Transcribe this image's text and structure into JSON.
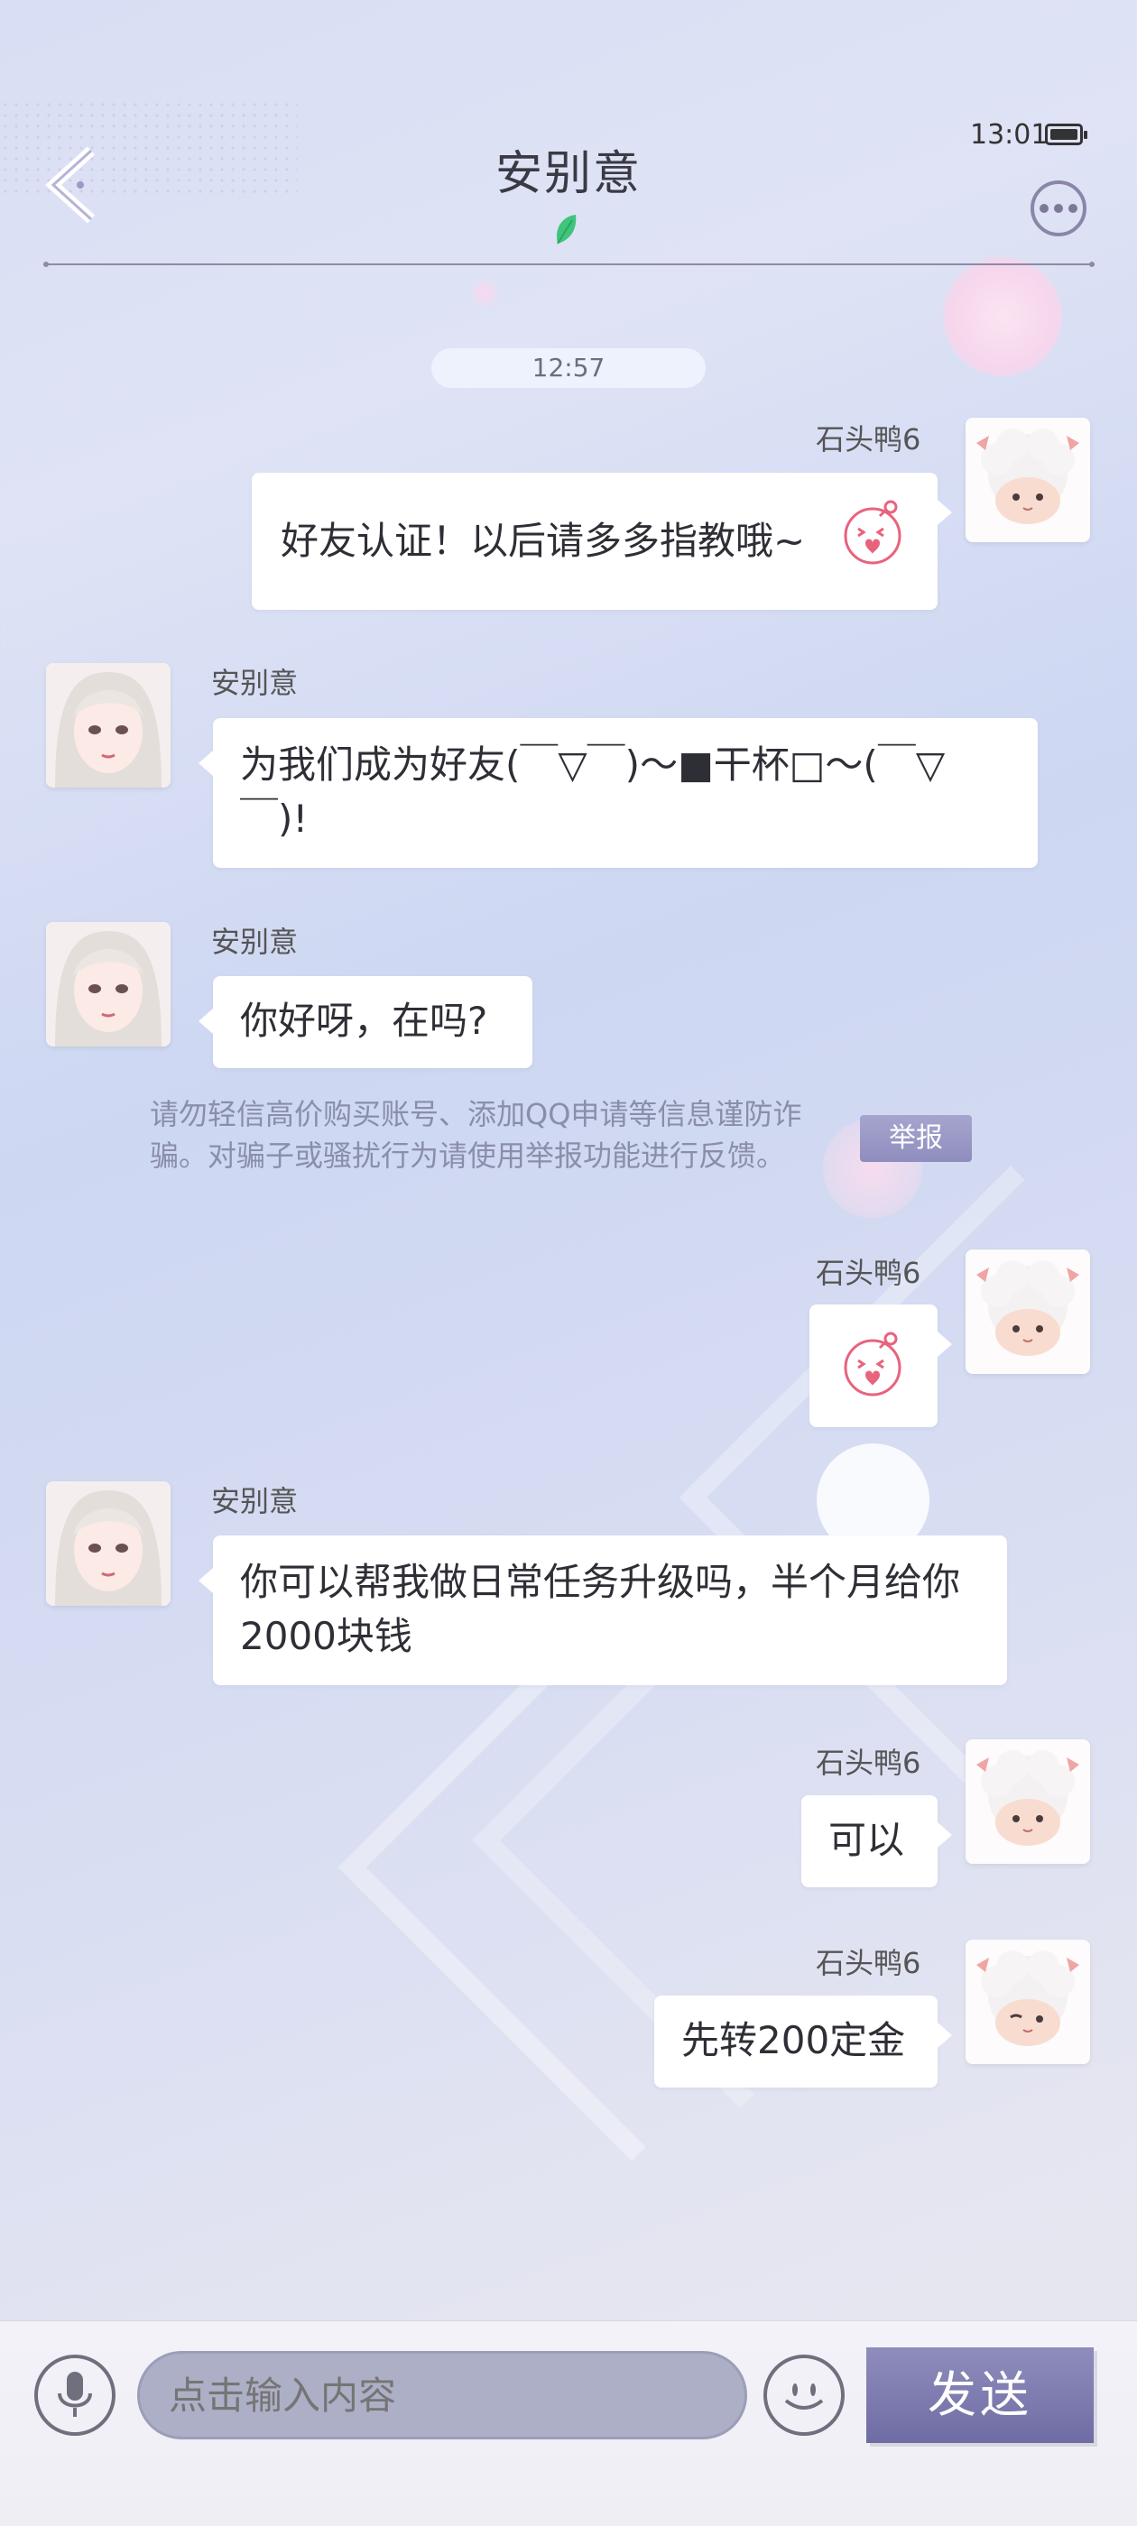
{
  "header": {
    "title": "安别意",
    "time": "13:01",
    "back_icon": "chevron-left-icon",
    "more_icon": "ellipsis-icon"
  },
  "chat": {
    "timestamp": "12:57",
    "messages": [
      {
        "sender": "石头鸭6",
        "side": "right",
        "text": "好友认证！以后请多多指教哦~",
        "sticker": "pink-blob-emoji"
      },
      {
        "sender": "安别意",
        "side": "left",
        "text": "为我们成为好友(￣▽￣)～■干杯□～(￣▽￣)!"
      },
      {
        "sender": "安别意",
        "side": "left",
        "text": "你好呀，在吗?"
      },
      {
        "sender": "石头鸭6",
        "side": "right",
        "text": "",
        "sticker": "pink-blob-emoji"
      },
      {
        "sender": "安别意",
        "side": "left",
        "text": "你可以帮我做日常任务升级吗，半个月给你2000块钱"
      },
      {
        "sender": "石头鸭6",
        "side": "right",
        "text": "可以"
      },
      {
        "sender": "石头鸭6",
        "side": "right",
        "text": "先转200定金"
      }
    ],
    "notice": "请勿轻信高价购买账号、添加QQ申请等信息谨防诈骗。对骗子或骚扰行为请使用举报功能进行反馈。",
    "report_label": "举报"
  },
  "input_bar": {
    "placeholder": "点击输入内容",
    "send_label": "发送",
    "mic_icon": "microphone-icon",
    "emoji_icon": "emoji-icon"
  },
  "colors": {
    "accent": "#8f8dbd",
    "bubble": "#ffffff",
    "notice_text": "#8a8ea8"
  }
}
